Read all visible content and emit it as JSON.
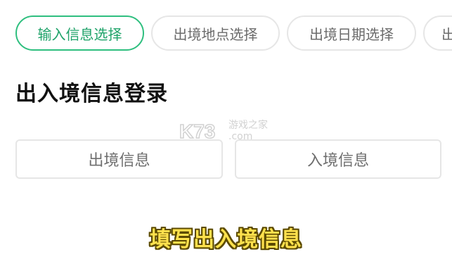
{
  "steps": [
    {
      "label": "输入信息选择",
      "active": true
    },
    {
      "label": "出境地点选择",
      "active": false
    },
    {
      "label": "出境日期选择",
      "active": false
    },
    {
      "label": "出",
      "active": false
    }
  ],
  "page": {
    "title": "出入境信息登录"
  },
  "options": {
    "exit_label": "出境信息",
    "entry_label": "入境信息"
  },
  "watermark": {
    "logo_text": "K73",
    "line1": "游戏之家",
    "line2": ".com"
  },
  "caption": {
    "text": "填写出入境信息"
  },
  "colors": {
    "accent_green": "#2fbf7f",
    "border_gray": "#e6e6e6",
    "caption_yellow": "#ffe14d"
  }
}
